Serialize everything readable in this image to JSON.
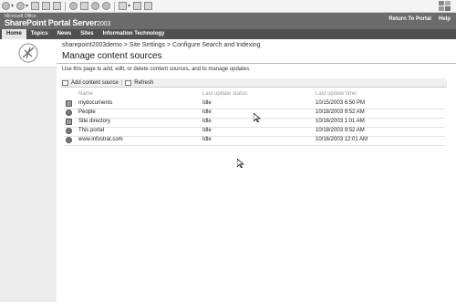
{
  "brand": {
    "small": "Microsoft Office",
    "main": "SharePoint Portal Server",
    "version": "2003"
  },
  "top_links": [
    "Return To Portal",
    "Help"
  ],
  "nav": [
    "Home",
    "Topics",
    "News",
    "Sites",
    "Information Technology"
  ],
  "breadcrumb": "sharepoint2003demo > Site Settings > Configure Search and Indexing",
  "page_title": "Manage content sources",
  "description": "Use this page to add, edit, or delete content sources, and to manage updates.",
  "actions": {
    "add": "Add content source",
    "separator": "|",
    "refresh": "Refresh"
  },
  "columns": {
    "name": "Name",
    "status": "Last update status:",
    "time": "Last update time:"
  },
  "rows": [
    {
      "name": "mydocuments",
      "status": "Idle",
      "time": "10/15/2003 6:50 PM",
      "icon": "folder-icon"
    },
    {
      "name": "People",
      "status": "Idle",
      "time": "10/18/2003 9:52 AM",
      "icon": "people-icon"
    },
    {
      "name": "Site directory",
      "status": "Idle",
      "time": "10/16/2003 1:01 AM",
      "icon": "site-directory-icon"
    },
    {
      "name": "This portal",
      "status": "Idle",
      "time": "10/18/2003 9:52 AM",
      "icon": "portal-icon"
    },
    {
      "name": "www.infostrat.com",
      "status": "Idle",
      "time": "10/16/2003 12:01 AM",
      "icon": "globe-icon"
    }
  ]
}
